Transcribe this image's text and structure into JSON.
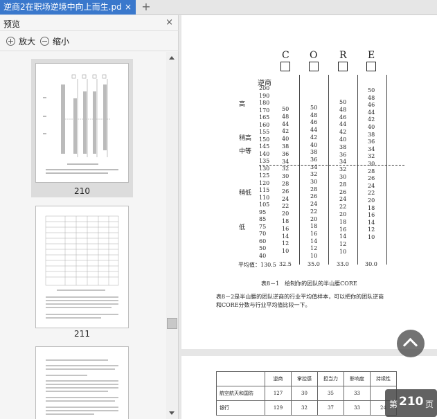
{
  "window": {
    "tab_title": "逆商2在职场逆境中向上而生.pd",
    "tab_close": "×",
    "new_tab": "+"
  },
  "sidebar": {
    "title": "预览",
    "close": "×",
    "zoom_in": "放大",
    "zoom_out": "缩小",
    "thumbnails": [
      {
        "label": "210",
        "selected": true
      },
      {
        "label": "211",
        "selected": false
      },
      {
        "label": "",
        "selected": false
      }
    ]
  },
  "document": {
    "columns": [
      "C",
      "O",
      "R",
      "E"
    ],
    "axis_label": "逆商",
    "scale": [
      "200",
      "190",
      "180",
      "170",
      "165",
      "160",
      "155",
      "150",
      "145",
      "140",
      "135",
      "130",
      "125",
      "120",
      "115",
      "110",
      "105",
      "95",
      "85",
      "75",
      "70",
      "60",
      "50",
      "40"
    ],
    "bands": [
      "高",
      "稍高",
      "中等",
      "稍低",
      "低"
    ],
    "col_c": [
      "50",
      "48",
      "44",
      "42",
      "40",
      "38",
      "36",
      "34",
      "32",
      "30",
      "28",
      "26",
      "24",
      "22",
      "20",
      "18",
      "16",
      "14",
      "12",
      "10"
    ],
    "col_o": [
      "50",
      "48",
      "46",
      "44",
      "42",
      "40",
      "38",
      "36",
      "34",
      "32",
      "30",
      "28",
      "26",
      "24",
      "22",
      "20",
      "18",
      "16",
      "14",
      "12",
      "10"
    ],
    "col_r": [
      "50",
      "48",
      "46",
      "44",
      "42",
      "40",
      "38",
      "36",
      "34",
      "32",
      "30",
      "28",
      "26",
      "24",
      "22",
      "20",
      "18",
      "16",
      "14",
      "12",
      "10"
    ],
    "col_e": [
      "50",
      "48",
      "46",
      "44",
      "42",
      "40",
      "38",
      "36",
      "34",
      "32",
      "30",
      "28",
      "26",
      "24",
      "22",
      "20",
      "18",
      "16",
      "14",
      "12",
      "10"
    ],
    "averages_label": "平均值：130.5",
    "averages": [
      "32.5",
      "35.0",
      "33.0",
      "30.0"
    ],
    "caption": "表8－1　绘制你的团队的半山腰CORE",
    "paragraph_line1": "表8－2是半山腰的团队逆商的行业平均值样本，可以把你的团队逆商",
    "paragraph_line2": "和CORE分数与行业平均值比较一下。",
    "table2": {
      "headers": [
        "",
        "逆商",
        "掌控感",
        "担当力",
        "影响度",
        "持续性"
      ],
      "rows": [
        [
          "航空航天和国防",
          "127",
          "30",
          "35",
          "33",
          ""
        ],
        [
          "银行",
          "129",
          "32",
          "37",
          "33",
          "24"
        ]
      ]
    },
    "page_indicator": {
      "prefix": "第",
      "number": "210",
      "suffix": "页"
    }
  }
}
